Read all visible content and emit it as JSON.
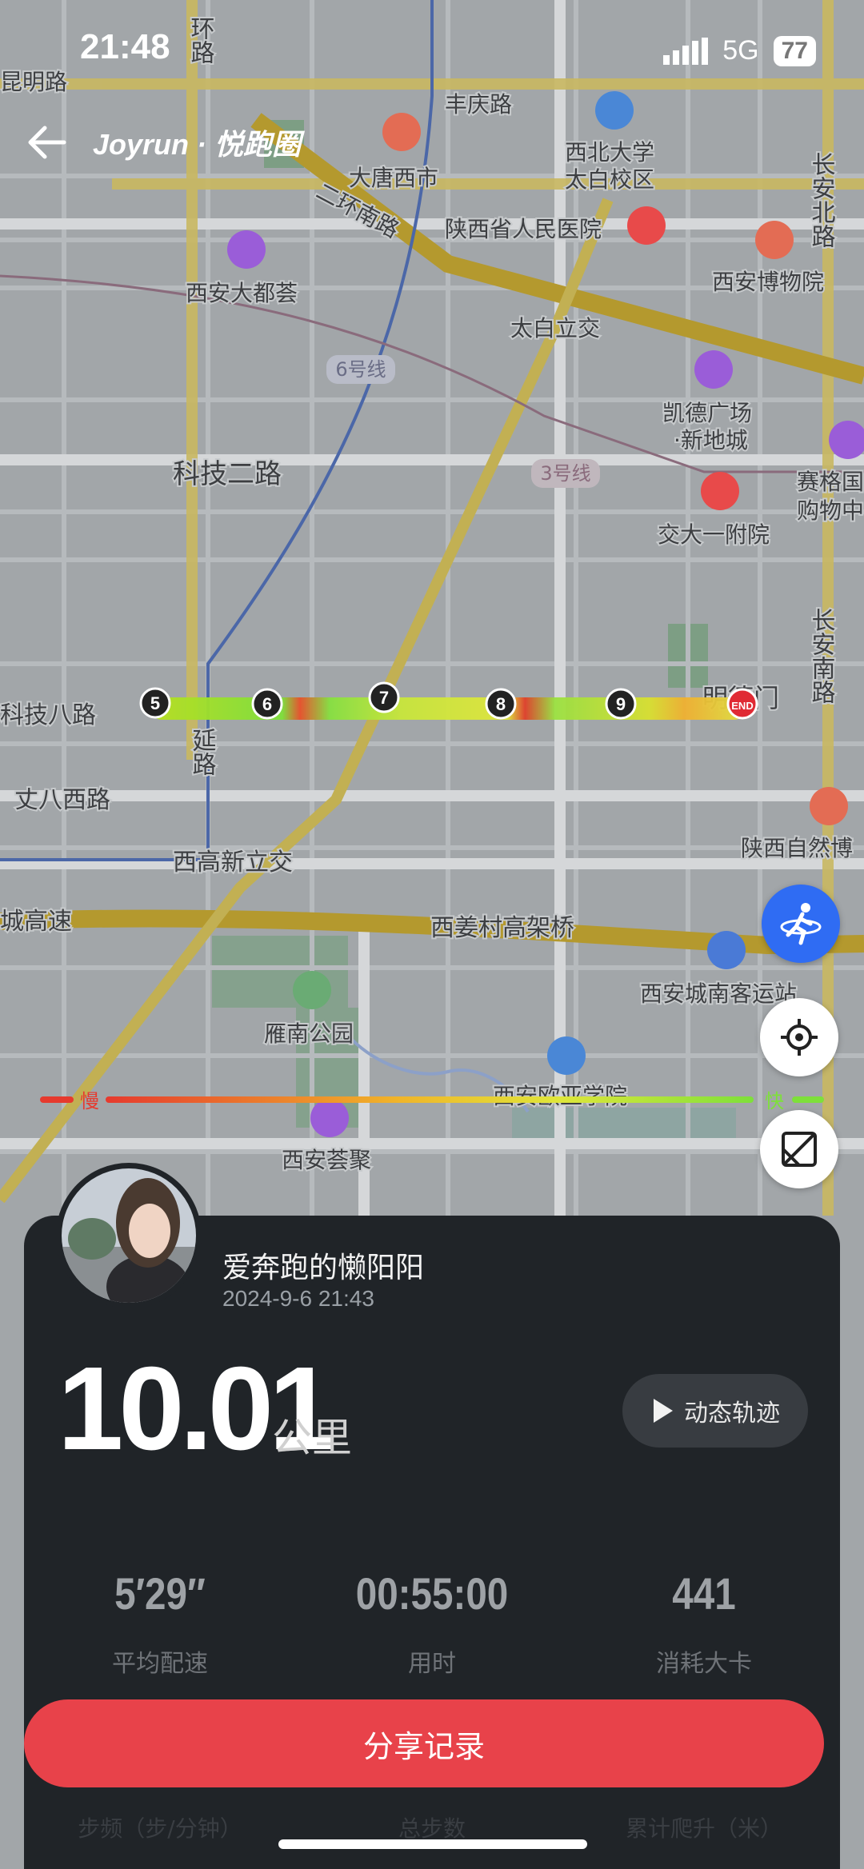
{
  "status_bar": {
    "time": "21:48",
    "network": "5G",
    "battery": "77"
  },
  "header": {
    "brand": "Joyrun · 悦跑圈"
  },
  "map": {
    "labels": [
      "昆明路",
      "丰庆路",
      "西北大学",
      "太白校区",
      "大唐西市",
      "二环南路",
      "陕西省人民医院",
      "西安博物院",
      "西安大都荟",
      "太白立交",
      "6号线",
      "凯德广场",
      "·新地城",
      "科技二路",
      "3号线",
      "交大一附院",
      "赛格国",
      "购物中",
      "科技八路",
      "丈八西路",
      "西高新立交",
      "城高速",
      "西姜村高架桥",
      "西安城南客运站",
      "雁南公园",
      "西安欧亚学院",
      "西安荟聚",
      "长安北路",
      "长安南路",
      "陕西自然博",
      "明德门",
      "延路",
      "环路"
    ],
    "markers": [
      "5",
      "6",
      "7",
      "8",
      "9"
    ],
    "end_marker": "END"
  },
  "run": {
    "username": "爱奔跑的懒阳阳",
    "datetime": "2024-9-6 21:43",
    "distance": "10.01",
    "distance_unit": "公里",
    "animate_button": "动态轨迹",
    "pace_slow": "慢",
    "pace_fast": "快",
    "stats": [
      {
        "value": "5′29′′",
        "label": "平均配速"
      },
      {
        "value": "00:55:00",
        "label": "用时"
      },
      {
        "value": "441",
        "label": "消耗大卡"
      }
    ],
    "share_button": "分享记录",
    "more_labels": [
      "步频（步/分钟）",
      "总步数",
      "累计爬升（米）"
    ]
  },
  "colors": {
    "accent": "#e8424a",
    "fab_blue": "#2f6cf3",
    "panel": "#202428"
  }
}
